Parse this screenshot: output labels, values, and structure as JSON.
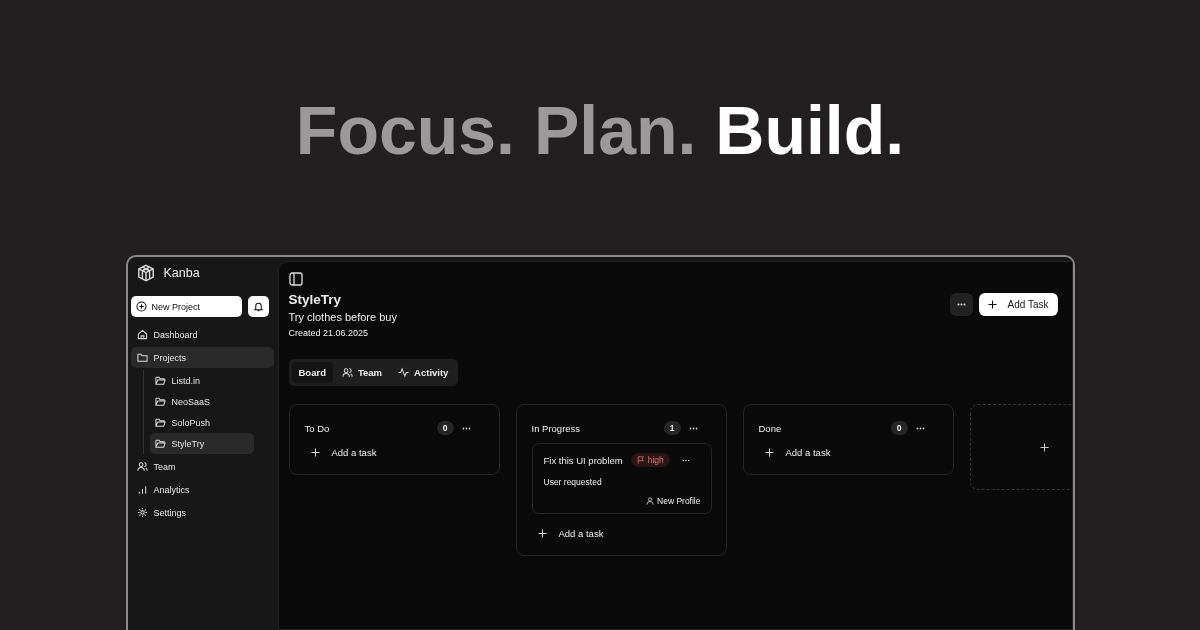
{
  "headline": [
    {
      "text": "Focus. Plan.",
      "emphasis": false
    },
    {
      "text": "Build.",
      "emphasis": true
    }
  ],
  "sidebar": {
    "app_name": "Kanba",
    "new_project_button": "New Project",
    "items": [
      {
        "label": "Dashboard",
        "selected": false
      },
      {
        "label": "Projects",
        "selected": true,
        "expanded": true,
        "children": [
          {
            "label": "Listd.in",
            "selected": false
          },
          {
            "label": "NeoSaaS",
            "selected": false
          },
          {
            "label": "SoloPush",
            "selected": false
          },
          {
            "label": "StyleTry",
            "selected": true
          }
        ]
      },
      {
        "label": "Team",
        "selected": false
      },
      {
        "label": "Analytics",
        "selected": false
      },
      {
        "label": "Settings",
        "selected": false
      }
    ]
  },
  "project": {
    "title": "StyleTry",
    "description": "Try clothes before buy",
    "created": "Created 21.06.2025",
    "add_task_button": "Add Task"
  },
  "tabs": [
    {
      "label": "Board",
      "selected": true
    },
    {
      "label": "Team",
      "selected": false
    },
    {
      "label": "Activity",
      "selected": false
    }
  ],
  "columns": [
    {
      "title": "To Do",
      "count": "0",
      "add_label": "Add a task"
    },
    {
      "title": "In Progress",
      "count": "1",
      "add_label": "Add a task",
      "tasks": [
        {
          "title": "Fix this UI problem",
          "priority": "high",
          "description": "User requested",
          "assignee": "New Profile"
        }
      ]
    },
    {
      "title": "Done",
      "count": "0",
      "add_label": "Add a task"
    }
  ]
}
